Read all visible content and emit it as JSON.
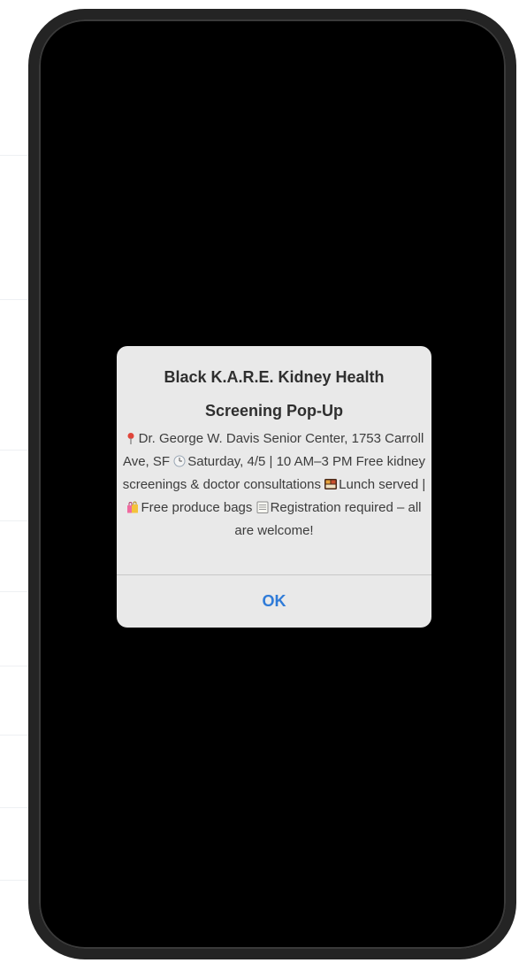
{
  "alert": {
    "title": "Black K.A.R.E. Kidney Health Screening Pop-Up",
    "message": {
      "location": "Dr. George W. Davis Senior Center, 1753 Carroll Ave, SF",
      "datetime": "Saturday, 4/5 | 10 AM–3 PM Free kidney screenings & doctor consultations",
      "lunch": "Lunch served |",
      "produce": "Free produce bags",
      "registration": "Registration required – all are welcome!"
    },
    "ok_label": "OK"
  },
  "icons": {
    "location": "pin-icon",
    "time": "clock-icon",
    "lunch": "bento-icon",
    "produce": "shopping-bags-icon",
    "registration": "notepad-icon"
  },
  "colors": {
    "ok_button": "#2f7bd8",
    "alert_background": "#e9e9e9",
    "phone_screen": "#000000"
  }
}
